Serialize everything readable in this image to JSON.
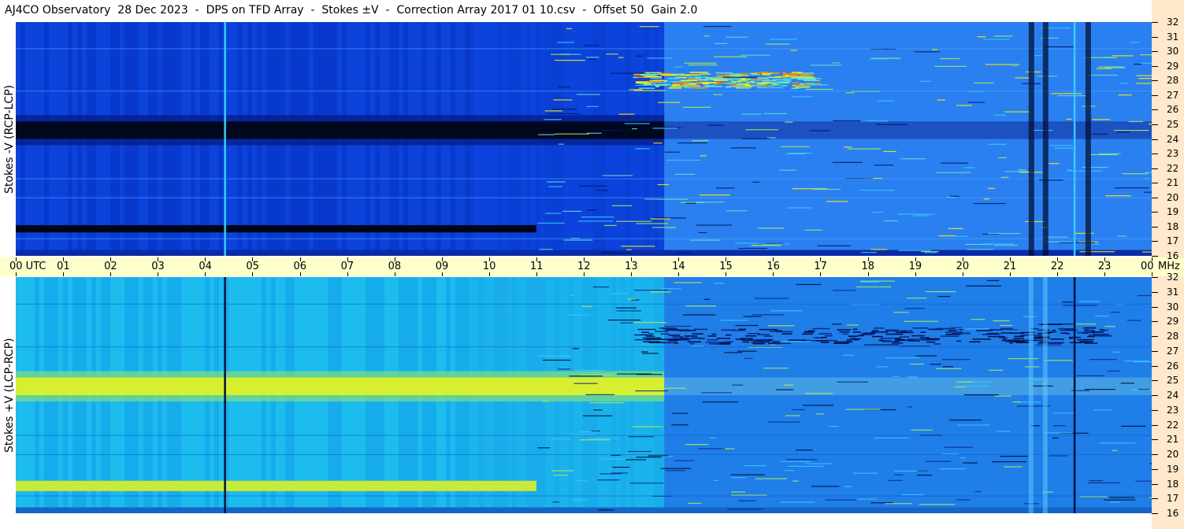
{
  "title": "AJ4CO Observatory  28 Dec 2023  -  DPS on TFD Array  -  Stokes ±V  -  Correction Array 2017 01 10.csv  -  Offset 50  Gain 2.0",
  "panels": {
    "top_label": "Stokes -V (RCP-LCP)",
    "bottom_label": "Stokes +V (LCP-RCP)"
  },
  "colors": {
    "y_axis_bg": "#ffe8cc",
    "x_axis_bg": "#ffffcc",
    "colormap": [
      "#000014",
      "#001a66",
      "#0033cc",
      "#0066ff",
      "#0099ff",
      "#33ccff",
      "#66ddcc",
      "#aaee55",
      "#ffee00",
      "#ff8800",
      "#ff0000"
    ]
  },
  "chart_data": [
    {
      "type": "heatmap",
      "name": "Stokes -V (RCP-LCP)",
      "x_unit": "UTC hour",
      "y_unit": "MHz",
      "xlim": [
        0,
        24
      ],
      "ylim": [
        16,
        32
      ],
      "features": {
        "dark_band_mhz": [
          24,
          25.2
        ],
        "dark_band_until_hour": 13.7,
        "second_dark_band_mhz": [
          17.6,
          18.1
        ],
        "active_region_start_hour": 13.7,
        "bright_emission_mhz": [
          27.5,
          28.6
        ],
        "bright_emission_hours": [
          13,
          16.8
        ],
        "vertical_line_hours": [
          4.4,
          22.35
        ],
        "dark_columns_hours": [
          21.4,
          21.7,
          22.6
        ]
      }
    },
    {
      "type": "heatmap",
      "name": "Stokes +V (LCP-RCP)",
      "x_unit": "UTC hour",
      "y_unit": "MHz",
      "xlim": [
        0,
        24
      ],
      "ylim": [
        16,
        32
      ],
      "features": {
        "bright_band_mhz": [
          24,
          25.2
        ],
        "bright_band_until_hour": 13.7,
        "second_bright_band_mhz": [
          17.5,
          18.2
        ],
        "active_region_start_hour": 13.7,
        "dark_emission_mhz": [
          27.5,
          28.6
        ],
        "vertical_line_hours": [
          4.4,
          22.35
        ]
      }
    }
  ],
  "y_ticks": [
    "32",
    "31",
    "30",
    "29",
    "28",
    "27",
    "26",
    "25",
    "24",
    "23",
    "22",
    "21",
    "20",
    "19",
    "18",
    "17",
    "16"
  ],
  "x_ticks": [
    "00 UTC",
    "01",
    "02",
    "03",
    "04",
    "05",
    "06",
    "07",
    "08",
    "09",
    "10",
    "11",
    "12",
    "13",
    "14",
    "15",
    "16",
    "17",
    "18",
    "19",
    "20",
    "21",
    "22",
    "23",
    "00"
  ],
  "x_unit_label": "MHz"
}
